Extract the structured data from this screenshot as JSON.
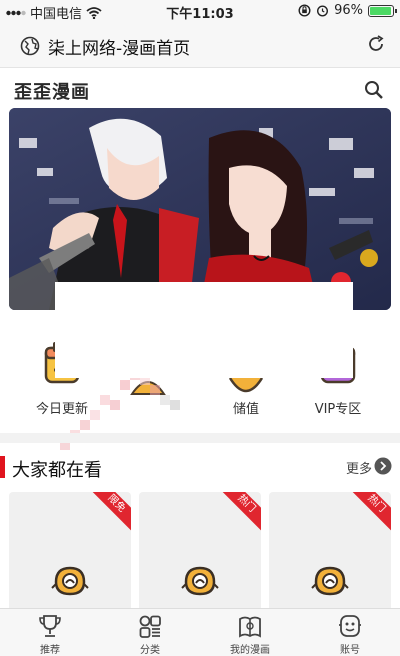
{
  "status_bar": {
    "carrier": "中国电信",
    "time": "下午11:03",
    "battery_percent": "96%",
    "battery_level": 0.96,
    "battery_color": "#4cd964"
  },
  "browser": {
    "title": "柒上网络-漫画首页",
    "globe_icon": "globe-icon",
    "reload_icon": "reload-icon"
  },
  "app": {
    "logo_text": "歪歪漫画",
    "search_icon": "search-icon"
  },
  "banner": {
    "description_icon": "comic-banner-image"
  },
  "categories": [
    {
      "label": "今日更新",
      "icon": "calendar-icon"
    },
    {
      "label": "",
      "icon": "fish-icon"
    },
    {
      "label": "储值",
      "icon": "coin-icon"
    },
    {
      "label": "VIP专区",
      "icon": "vip-calendar-icon"
    }
  ],
  "section": {
    "title": "大家都在看",
    "more_label": "更多",
    "accent_color": "#e0141e"
  },
  "cards": [
    {
      "badge": "限免"
    },
    {
      "badge": "热门"
    },
    {
      "badge": "热门"
    }
  ],
  "tabbar": {
    "items": [
      {
        "label": "推荐",
        "icon": "trophy-icon"
      },
      {
        "label": "分类",
        "icon": "category-icon"
      },
      {
        "label": "我的漫画",
        "icon": "book-icon"
      },
      {
        "label": "账号",
        "icon": "user-icon"
      }
    ]
  }
}
